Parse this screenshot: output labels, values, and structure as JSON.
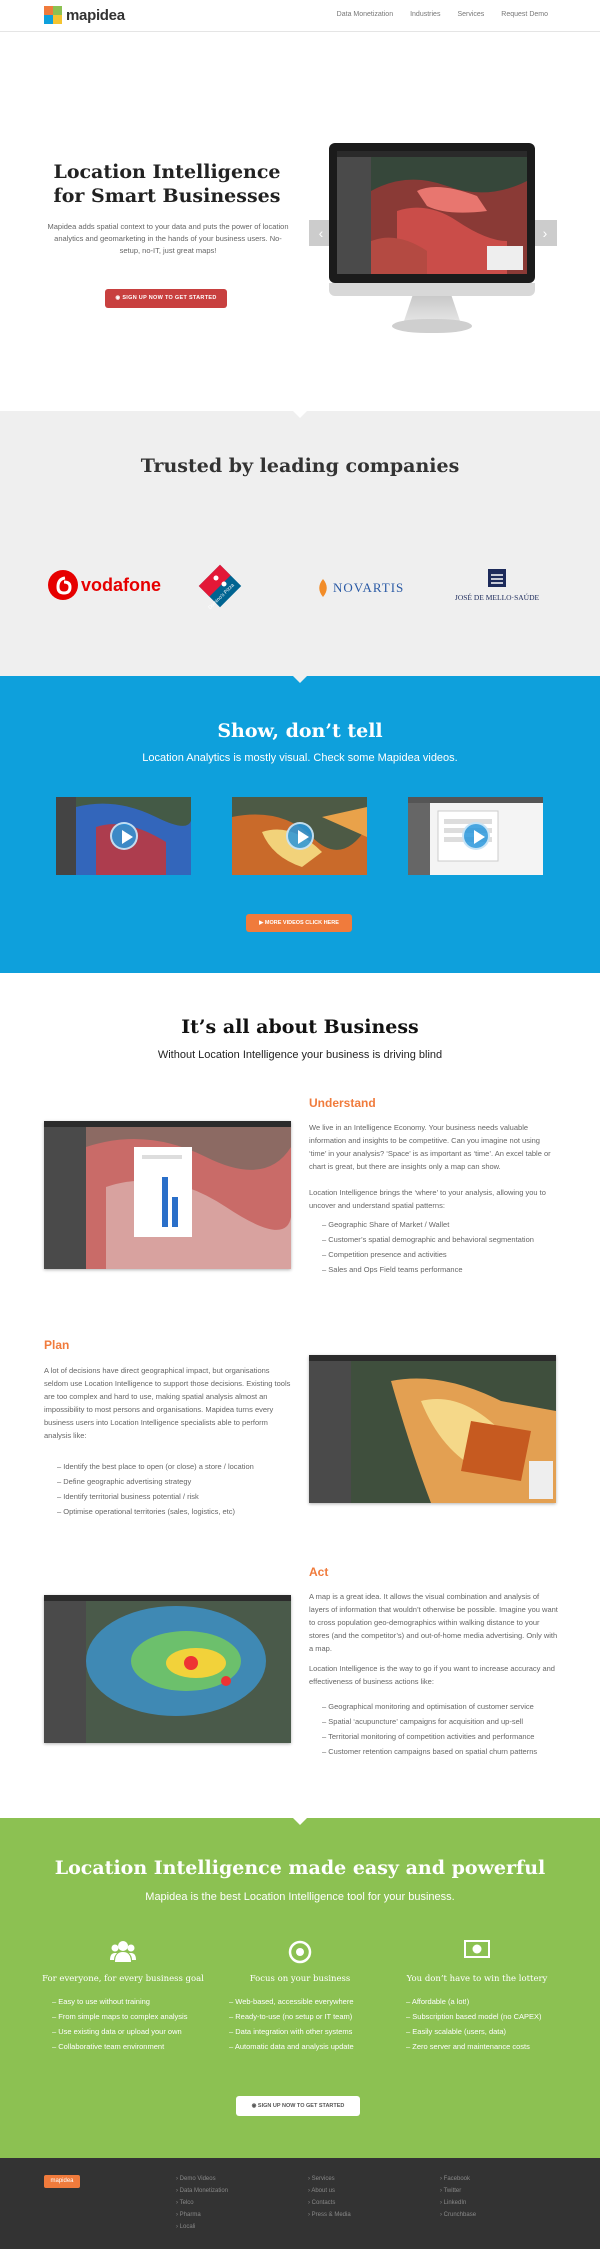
{
  "header": {
    "logo_text": "mapidea",
    "nav": [
      "Data Monetization",
      "Industries",
      "Services",
      "Request Demo"
    ]
  },
  "hero": {
    "title": "Location Intelligence for Smart Businesses",
    "subtitle": "Mapidea adds spatial context to your data and puts the power of location analytics and geomarketing in the hands of your business users. No-setup, no-IT, just great maps!",
    "cta": "SIGN UP NOW TO GET STARTED"
  },
  "trusted": {
    "title": "Trusted by leading companies",
    "logos": [
      "vodafone",
      "Domino's Pizza",
      "NOVARTIS",
      "JOSÉ DE MELLO·SAÚDE"
    ]
  },
  "videos": {
    "title": "Show, don’t tell",
    "subtitle": "Location Analytics is mostly visual. Check some Mapidea videos.",
    "cta": "MORE VIDEOS CLICK HERE"
  },
  "business": {
    "title": "It’s all about Business",
    "subtitle": "Without Location Intelligence your business is driving blind",
    "understand": {
      "heading": "Understand",
      "para1": "We live in an Intelligence Economy. Your business needs valuable information and insights to be competitive. Can you imagine not using ‘time’ in your analysis? ‘Space’ is as important as ‘time’. An excel table or chart is great, but there are insights only a map can show.",
      "para2": "Location Intelligence brings the ‘where’ to your analysis, allowing you to uncover and understand spatial patterns:",
      "items": [
        "Geographic Share of Market / Wallet",
        "Customer’s spatial demographic and behavioral segmentation",
        "Competition presence and activities",
        "Sales and Ops Field teams performance"
      ]
    },
    "plan": {
      "heading": "Plan",
      "para": "A lot of decisions have direct geographical impact, but organisations seldom use Location Intelligence to support those decisions. Existing tools are too complex and hard to use, making spatial analysis almost an impossibility to most persons and organisations. Mapidea turns every business users into Location Intelligence specialists able to perform analysis like:",
      "items": [
        "Identify the best place to open (or close) a store / location",
        "Define geographic advertising strategy",
        "Identify territorial business potential / risk",
        "Optimise operational territories (sales, logistics, etc)"
      ]
    },
    "act": {
      "heading": "Act",
      "para1": "A map is a great idea. It allows the visual combination and analysis of layers of information that wouldn’t otherwise be possible. Imagine you want to cross population geo-demographics within walking distance to your stores (and the competitor’s) and out-of-home media advertising. Only with a map.",
      "para2": "Location Intelligence is the way to go if you want to increase accuracy and effectiveness of business actions like:",
      "items": [
        "Geographical monitoring and optimisation of customer service",
        "Spatial ‘acupuncture’ campaigns for acquisition and up-sell",
        "Territorial monitoring of competition activities and performance",
        "Customer retention campaigns based on spatial churn patterns"
      ]
    }
  },
  "features": {
    "title": "Location Intelligence made easy and powerful",
    "subtitle": "Mapidea is the best Location Intelligence tool for your business.",
    "columns": [
      {
        "icon": "users-icon",
        "heading": "For everyone, for every business goal",
        "items": [
          "Easy to use without training",
          "From simple maps to complex analysis",
          "Use existing data or upload your own",
          "Collaborative team environment"
        ]
      },
      {
        "icon": "target-icon",
        "heading": "Focus on your business",
        "items": [
          "Web-based, accessible everywhere",
          "Ready-to-use (no setup or IT team)",
          "Data integration with other systems",
          "Automatic data and analysis update"
        ]
      },
      {
        "icon": "money-icon",
        "heading": "You don’t have to win the lottery",
        "items": [
          "Affordable (a lot!)",
          "Subscription based model (no CAPEX)",
          "Easily scalable (users, data)",
          "Zero server and maintenance costs"
        ]
      }
    ],
    "cta": "SIGN UP NOW TO GET STARTED"
  },
  "footer": {
    "logo_text": "mapidea",
    "col1": [
      "Demo Videos",
      "Data Monetization",
      "Telco",
      "Pharma",
      "Locali"
    ],
    "col2": [
      "Services",
      "About us",
      "Contacts",
      "Press & Media"
    ],
    "col3": [
      "Facebook",
      "Twitter",
      "LinkedIn",
      "Crunchbase"
    ]
  },
  "colors": {
    "accent_orange": "#f07b3c",
    "brand_blue": "#0ea0dc",
    "brand_green": "#8cc152",
    "cta_red": "#c8403f"
  }
}
